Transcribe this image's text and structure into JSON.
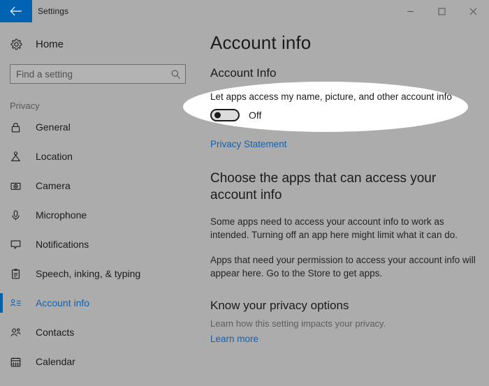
{
  "window": {
    "title": "Settings",
    "back_icon": "back-arrow-icon",
    "controls": {
      "minimize": "minimize-icon",
      "maximize": "maximize-icon",
      "close": "close-icon"
    }
  },
  "sidebar": {
    "home": {
      "label": "Home",
      "icon": "gear-icon"
    },
    "search": {
      "placeholder": "Find a setting",
      "value": "",
      "icon": "search-icon"
    },
    "section_label": "Privacy",
    "items": [
      {
        "label": "General",
        "icon": "lock-icon",
        "selected": false
      },
      {
        "label": "Location",
        "icon": "location-pin-icon",
        "selected": false
      },
      {
        "label": "Camera",
        "icon": "camera-icon",
        "selected": false
      },
      {
        "label": "Microphone",
        "icon": "microphone-icon",
        "selected": false
      },
      {
        "label": "Notifications",
        "icon": "speech-bubble-icon",
        "selected": false
      },
      {
        "label": "Speech, inking, & typing",
        "icon": "clipboard-icon",
        "selected": false
      },
      {
        "label": "Account info",
        "icon": "contact-card-icon",
        "selected": true
      },
      {
        "label": "Contacts",
        "icon": "people-icon",
        "selected": false
      },
      {
        "label": "Calendar",
        "icon": "calendar-icon",
        "selected": false
      }
    ]
  },
  "main": {
    "page_title": "Account info",
    "group_title": "Account Info",
    "toggle": {
      "description": "Let apps access my name, picture, and other account info",
      "state_label": "Off",
      "state": "off"
    },
    "privacy_statement_link": "Privacy Statement",
    "apps_section": {
      "heading": "Choose the apps that can access your account info",
      "paragraph_1": "Some apps need to access your account info to work as intended. Turning off an app here might limit what it can do.",
      "paragraph_2": "Apps that need your permission to access your account info will appear here. Go to the Store to get apps."
    },
    "privacy_options": {
      "heading": "Know your privacy options",
      "description": "Learn how this setting impacts your privacy.",
      "learn_more_link": "Learn more"
    }
  },
  "colors": {
    "accent": "#0063b1",
    "link": "#1361ab",
    "background": "#acacac",
    "highlight": "#ffffff"
  }
}
